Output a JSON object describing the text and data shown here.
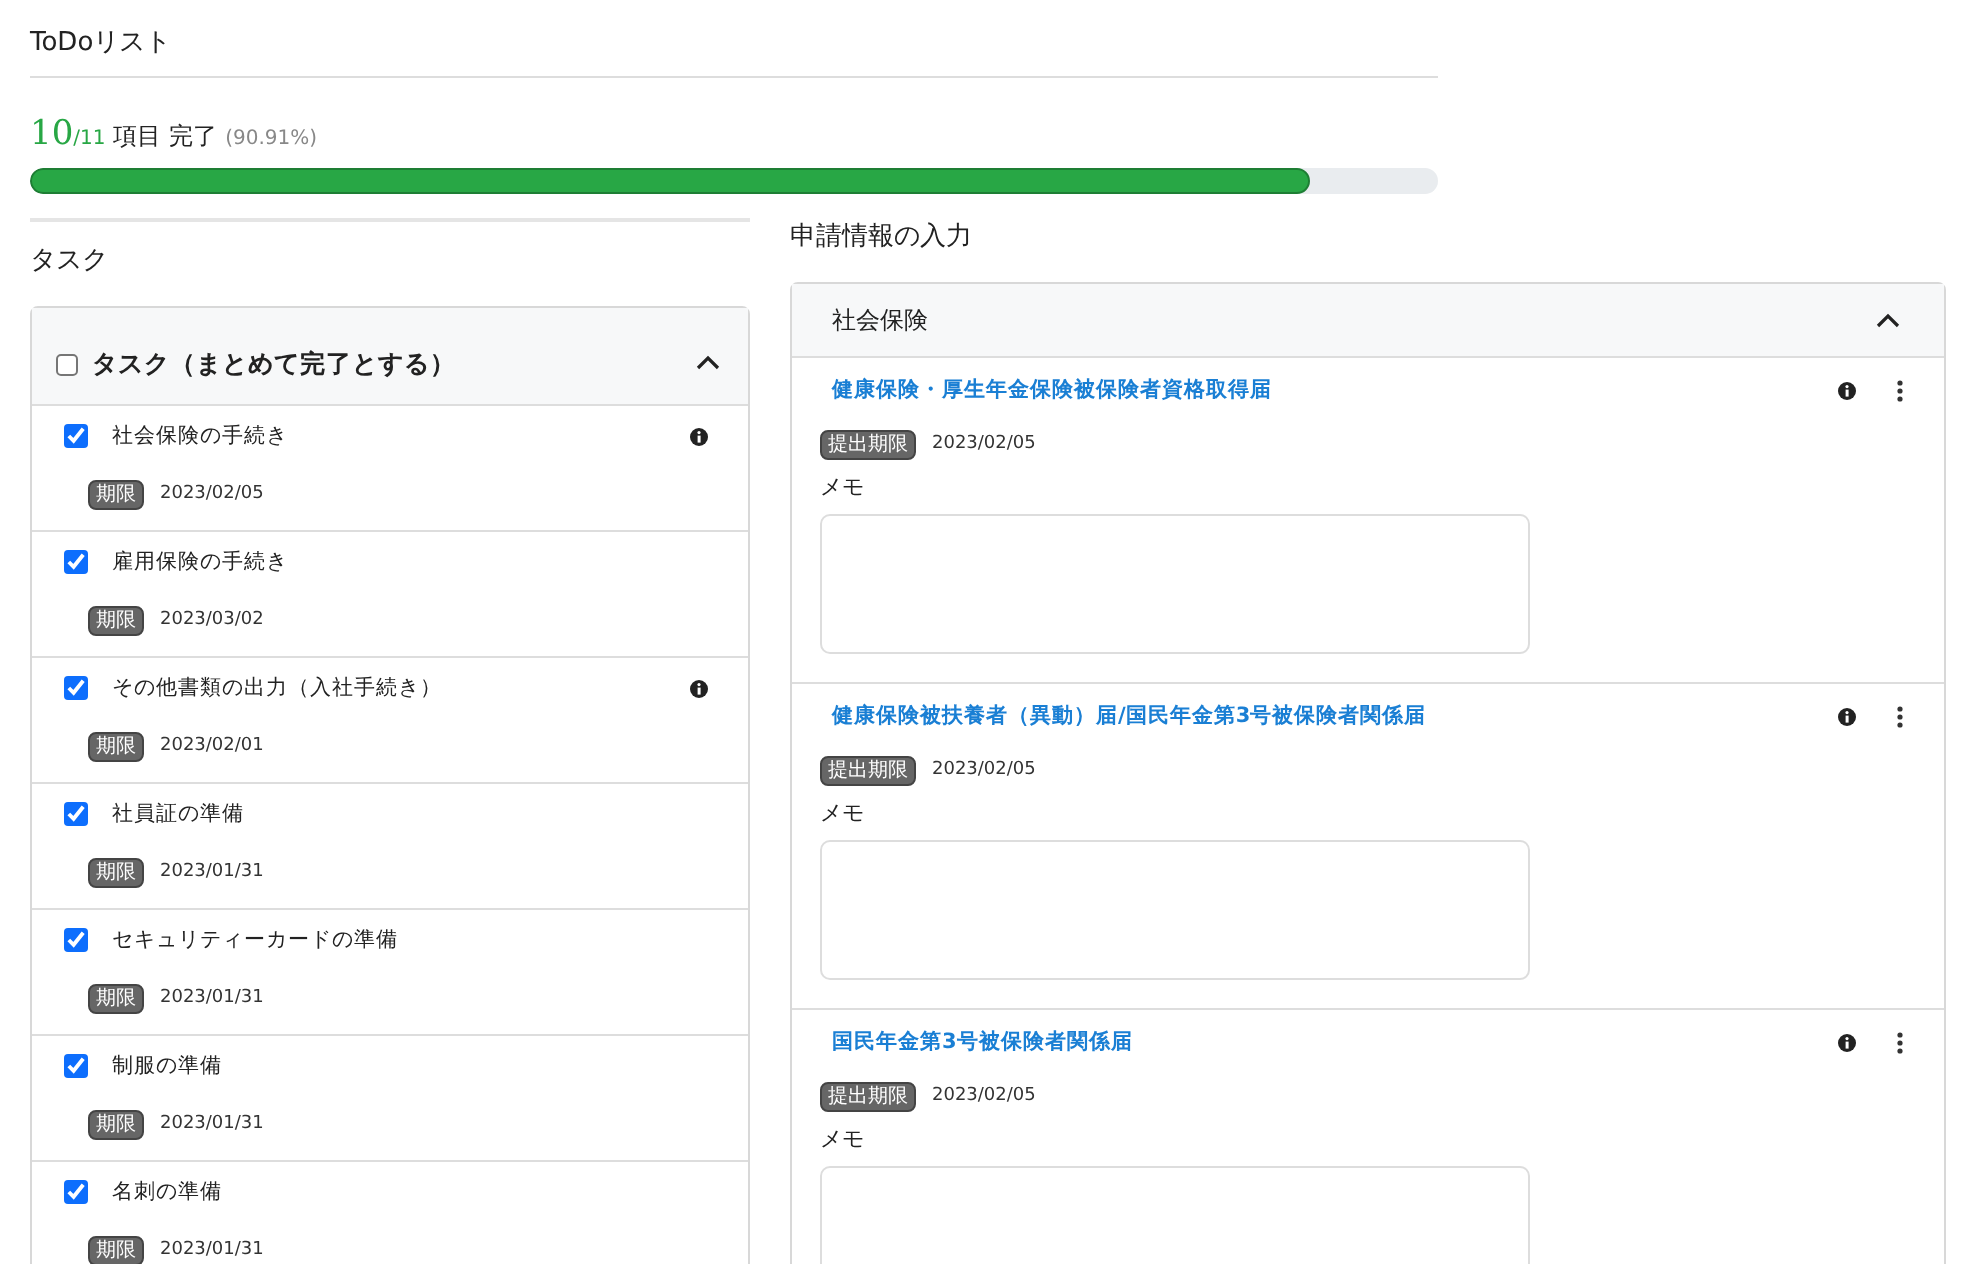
{
  "header": {
    "title": "ToDoリスト"
  },
  "progress": {
    "done": "10",
    "total": "/11",
    "label": "項目 完了",
    "percent": "(90.91%)",
    "level": 0.9091
  },
  "tasks": {
    "title": "タスク",
    "group": {
      "label": "タスク（まとめて完了とする）",
      "checked": false,
      "expanded": true
    },
    "items": [
      {
        "label": "社会保険の手続き",
        "checked": true,
        "info": true,
        "badge": "期限",
        "date": "2023/02/05"
      },
      {
        "label": "雇用保険の手続き",
        "checked": true,
        "info": false,
        "badge": "期限",
        "date": "2023/03/02"
      },
      {
        "label": "その他書類の出力（入社手続き）",
        "checked": true,
        "info": true,
        "badge": "期限",
        "date": "2023/02/01"
      },
      {
        "label": "社員証の準備",
        "checked": true,
        "info": false,
        "badge": "期限",
        "date": "2023/01/31"
      },
      {
        "label": "セキュリティーカードの準備",
        "checked": true,
        "info": false,
        "badge": "期限",
        "date": "2023/01/31"
      },
      {
        "label": "制服の準備",
        "checked": true,
        "info": false,
        "badge": "期限",
        "date": "2023/01/31"
      },
      {
        "label": "名刺の準備",
        "checked": true,
        "info": false,
        "badge": "期限",
        "date": "2023/01/31"
      }
    ]
  },
  "forms": {
    "title": "申請情報の入力",
    "section": {
      "label": "社会保険",
      "expanded": true
    },
    "items": [
      {
        "title": "健康保険・厚生年金保険被保険者資格取得届",
        "badge": "提出期限",
        "date": "2023/02/05",
        "memo_label": "メモ"
      },
      {
        "title": "健康保険被扶養者（異動）届/国民年金第3号被保険者関係届",
        "badge": "提出期限",
        "date": "2023/02/05",
        "memo_label": "メモ"
      },
      {
        "title": "国民年金第3号被保険者関係届",
        "badge": "提出期限",
        "date": "2023/02/05",
        "memo_label": "メモ"
      }
    ]
  }
}
